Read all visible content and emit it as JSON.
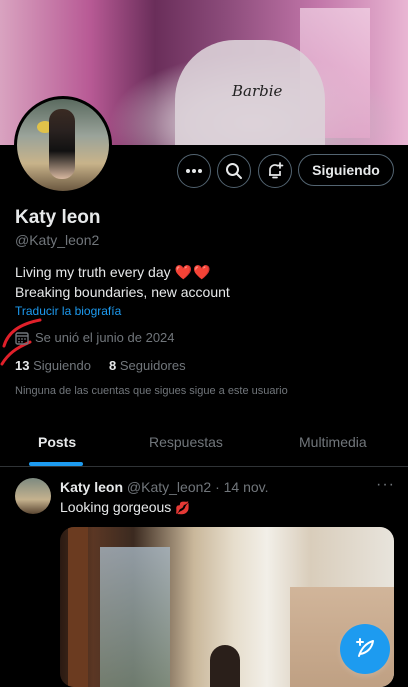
{
  "profile": {
    "name": "Katy leon",
    "handle": "@Katy_leon2",
    "bio_line1": "Living my truth every day",
    "bio_hearts": "❤️❤️",
    "bio_line2": "Breaking boundaries, new account",
    "translate_label": "Traducir la biografía",
    "joined": "Se unió el junio de 2024",
    "following_count": "13",
    "following_label": "Siguiendo",
    "followers_count": "8",
    "followers_label": "Seguidores",
    "mutuals_note": "Ninguna de las cuentas que sigues sigue a este usuario"
  },
  "banner": {
    "shirt_text": "Barbie"
  },
  "actions": {
    "follow_label": "Siguiendo",
    "more_icon": "more-icon",
    "search_icon": "search-icon",
    "notify_icon": "bell-plus-icon"
  },
  "tabs": [
    {
      "label": "Posts",
      "active": true
    },
    {
      "label": "Respuestas",
      "active": false
    },
    {
      "label": "Multimedia",
      "active": false
    }
  ],
  "tweet": {
    "author": "Katy leon",
    "handle": "@Katy_leon2",
    "separator": "·",
    "date": "14 nov.",
    "text": "Looking gorgeous",
    "emoji": "💋",
    "more": "···"
  },
  "colors": {
    "accent": "#1d9bf0",
    "text": "#e7e9ea",
    "muted": "#71767b",
    "heart": "#f4212e",
    "background": "#000000"
  }
}
